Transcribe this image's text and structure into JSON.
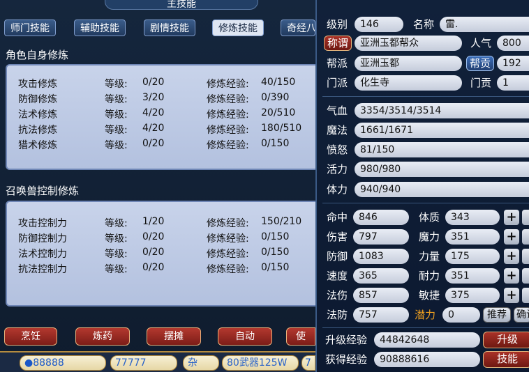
{
  "left": {
    "title": "主技能",
    "tabs": [
      "师门技能",
      "辅助技能",
      "剧情技能",
      "修炼技能",
      "奇经八"
    ],
    "section1_title": "角色自身修炼",
    "section1_rows": [
      {
        "name": "攻击修炼",
        "level_label": "等级:",
        "level": "0/20",
        "exp_label": "修炼经验:",
        "exp": "40/150"
      },
      {
        "name": "防御修炼",
        "level_label": "等级:",
        "level": "3/20",
        "exp_label": "修炼经验:",
        "exp": "0/390"
      },
      {
        "name": "法术修炼",
        "level_label": "等级:",
        "level": "4/20",
        "exp_label": "修炼经验:",
        "exp": "20/510"
      },
      {
        "name": "抗法修炼",
        "level_label": "等级:",
        "level": "4/20",
        "exp_label": "修炼经验:",
        "exp": "180/510"
      },
      {
        "name": "猎术修炼",
        "level_label": "等级:",
        "level": "0/20",
        "exp_label": "修炼经验:",
        "exp": "0/150"
      }
    ],
    "section2_title": "召唤兽控制修炼",
    "section2_rows": [
      {
        "name": "攻击控制力",
        "level_label": "等级:",
        "level": "1/20",
        "exp_label": "修炼经验:",
        "exp": "150/210"
      },
      {
        "name": "防御控制力",
        "level_label": "等级:",
        "level": "0/20",
        "exp_label": "修炼经验:",
        "exp": "0/150"
      },
      {
        "name": "法术控制力",
        "level_label": "等级:",
        "level": "0/20",
        "exp_label": "修炼经验:",
        "exp": "0/150"
      },
      {
        "name": "抗法控制力",
        "level_label": "等级:",
        "level": "0/20",
        "exp_label": "修炼经验:",
        "exp": "0/150"
      }
    ],
    "buttons": [
      "烹饪",
      "炼药",
      "摆摊",
      "自动",
      "使"
    ],
    "bottom_bar": {
      "seg1": "●88888",
      "seg2": "77777",
      "seg3": "杂",
      "seg4": "80武器125W",
      "seg5": "7"
    }
  },
  "right": {
    "level_label": "级别",
    "level": "146",
    "name_label": "名称",
    "name": "雷.",
    "title_btn": "称谓",
    "title_value": "亚洲玉都帮众",
    "popularity_label": "人气",
    "popularity": "800",
    "guild_label": "帮派",
    "guild": "亚洲玉都",
    "contrib_btn": "帮贡",
    "contrib": "192",
    "school_label": "门派",
    "school": "化生寺",
    "school_contrib_label": "门贡",
    "school_contrib": "1",
    "hp_label": "气血",
    "hp": "3354/3514/3514",
    "mp_label": "魔法",
    "mp": "1661/1671",
    "anger_label": "愤怒",
    "anger": "81/150",
    "vitality_label": "活力",
    "vitality": "980/980",
    "stamina_label": "体力",
    "stamina": "940/940",
    "stats_left": [
      {
        "label": "命中",
        "value": "846"
      },
      {
        "label": "伤害",
        "value": "797"
      },
      {
        "label": "防御",
        "value": "1083"
      },
      {
        "label": "速度",
        "value": "365"
      },
      {
        "label": "法伤",
        "value": "857"
      },
      {
        "label": "法防",
        "value": "757"
      }
    ],
    "stats_right": [
      {
        "label": "体质",
        "value": "343"
      },
      {
        "label": "魔力",
        "value": "351"
      },
      {
        "label": "力量",
        "value": "175"
      },
      {
        "label": "耐力",
        "value": "351"
      },
      {
        "label": "敏捷",
        "value": "375"
      }
    ],
    "potential_label": "潜力",
    "potential": "0",
    "recommend_btn": "推荐",
    "confirm_btn": "确认",
    "levelup_exp_label": "升级经验",
    "levelup_exp": "44842648",
    "levelup_btn": "升级",
    "gained_exp_label": "获得经验",
    "gained_exp": "90888616",
    "skills_btn": "技能",
    "plus_symbol": "+",
    "colors": {
      "potential": "#f0a020",
      "accent_red": "#a93228",
      "accent_blue": "#3b6db8"
    }
  }
}
